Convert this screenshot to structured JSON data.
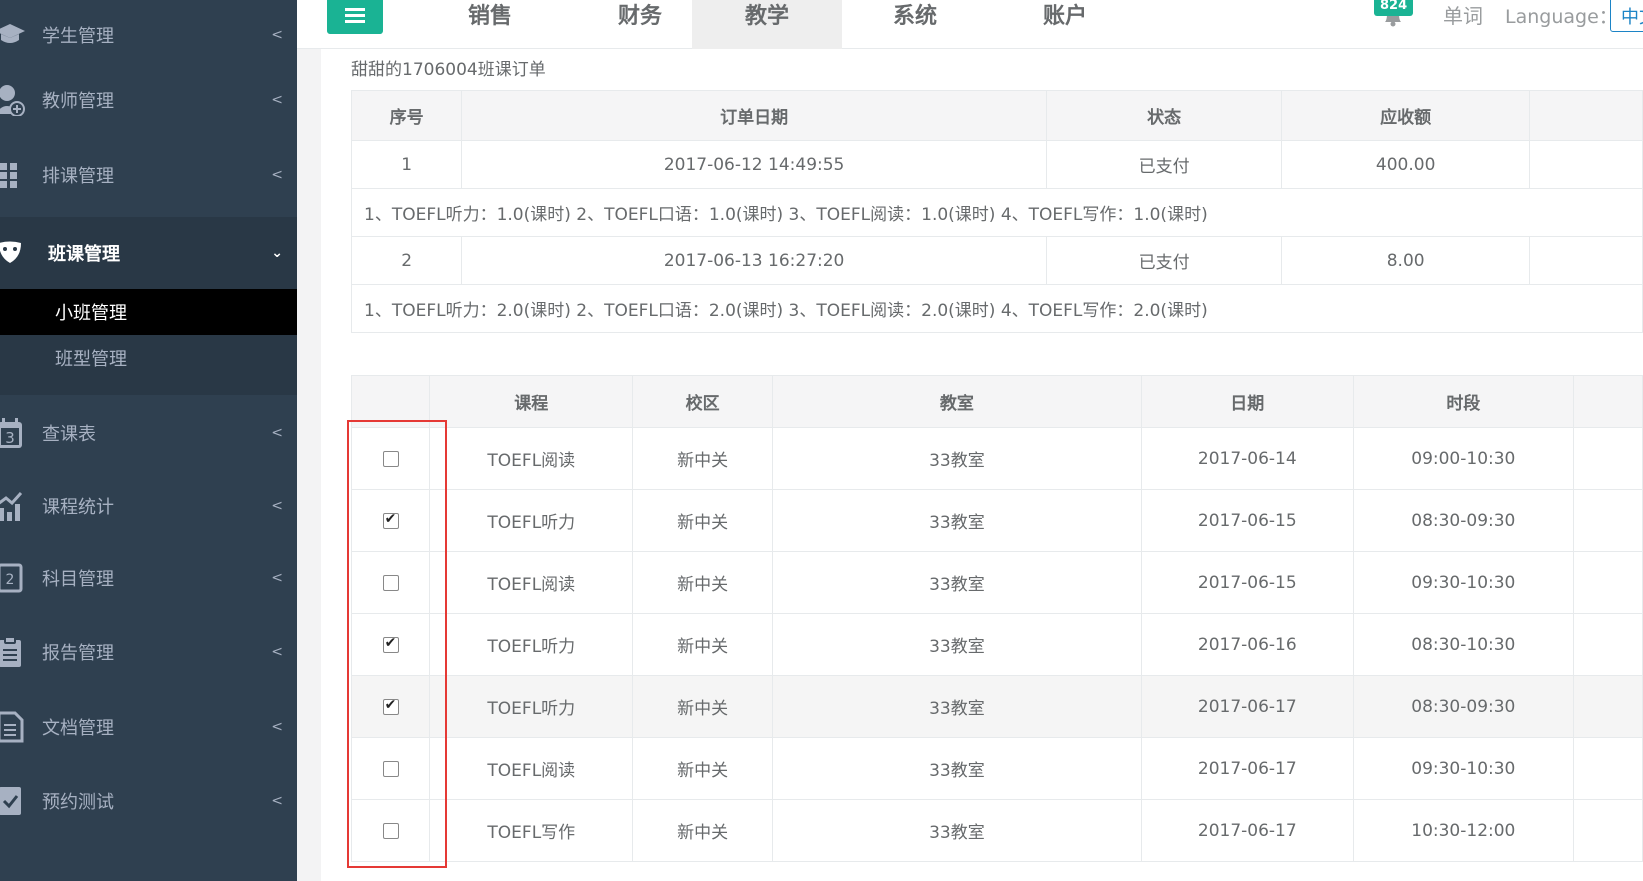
{
  "sidebar": {
    "items": [
      {
        "label": "学生管理",
        "icon": "graduation-cap-icon"
      },
      {
        "label": "教师管理",
        "icon": "teacher-add-icon"
      },
      {
        "label": "排课管理",
        "icon": "grid-icon"
      },
      {
        "label": "班课管理",
        "icon": "mask-icon"
      },
      {
        "label": "查课表",
        "icon": "calendar-icon"
      },
      {
        "label": "课程统计",
        "icon": "bar-chart-icon"
      },
      {
        "label": "科目管理",
        "icon": "subject-icon"
      },
      {
        "label": "报告管理",
        "icon": "report-icon"
      },
      {
        "label": "文档管理",
        "icon": "document-icon"
      },
      {
        "label": "预约测试",
        "icon": "booking-icon"
      }
    ],
    "sub_items": [
      {
        "label": "小班管理"
      },
      {
        "label": "班型管理"
      }
    ]
  },
  "topbar": {
    "nav": [
      "销售",
      "财务",
      "教学",
      "系统",
      "账户"
    ],
    "active_nav": "教学",
    "notification_count": "824",
    "word_link": "单词",
    "language_label": "Language：",
    "language_value": "中文"
  },
  "page": {
    "title": "甜甜的1706004班课订单"
  },
  "orders": {
    "headers": [
      "序号",
      "订单日期",
      "状态",
      "应收额"
    ],
    "rows": [
      {
        "no": "1",
        "date": "2017-06-12 14:49:55",
        "status": "已支付",
        "amount": "400.00",
        "detail": "1、TOEFL听力：1.0(课时)  2、TOEFL口语：1.0(课时)  3、TOEFL阅读：1.0(课时)  4、TOEFL写作：1.0(课时)"
      },
      {
        "no": "2",
        "date": "2017-06-13 16:27:20",
        "status": "已支付",
        "amount": "8.00",
        "detail": "1、TOEFL听力：2.0(课时)  2、TOEFL口语：2.0(课时)  3、TOEFL阅读：2.0(课时)  4、TOEFL写作：2.0(课时)"
      }
    ]
  },
  "schedule": {
    "headers": [
      "",
      "课程",
      "校区",
      "教室",
      "日期",
      "时段"
    ],
    "rows": [
      {
        "checked": false,
        "course": "TOEFL阅读",
        "campus": "新中关",
        "room": "33教室",
        "date": "2017-06-14",
        "time": "09:00-10:30"
      },
      {
        "checked": true,
        "course": "TOEFL听力",
        "campus": "新中关",
        "room": "33教室",
        "date": "2017-06-15",
        "time": "08:30-09:30"
      },
      {
        "checked": false,
        "course": "TOEFL阅读",
        "campus": "新中关",
        "room": "33教室",
        "date": "2017-06-15",
        "time": "09:30-10:30"
      },
      {
        "checked": true,
        "course": "TOEFL听力",
        "campus": "新中关",
        "room": "33教室",
        "date": "2017-06-16",
        "time": "08:30-10:30"
      },
      {
        "checked": true,
        "course": "TOEFL听力",
        "campus": "新中关",
        "room": "33教室",
        "date": "2017-06-17",
        "time": "08:30-09:30"
      },
      {
        "checked": false,
        "course": "TOEFL阅读",
        "campus": "新中关",
        "room": "33教室",
        "date": "2017-06-17",
        "time": "09:30-10:30"
      },
      {
        "checked": false,
        "course": "TOEFL写作",
        "campus": "新中关",
        "room": "33教室",
        "date": "2017-06-17",
        "time": "10:30-12:00"
      }
    ]
  },
  "colors": {
    "sidebar_bg": "#2f4050",
    "accent": "#1ab394",
    "highlight_box": "#e53935"
  }
}
